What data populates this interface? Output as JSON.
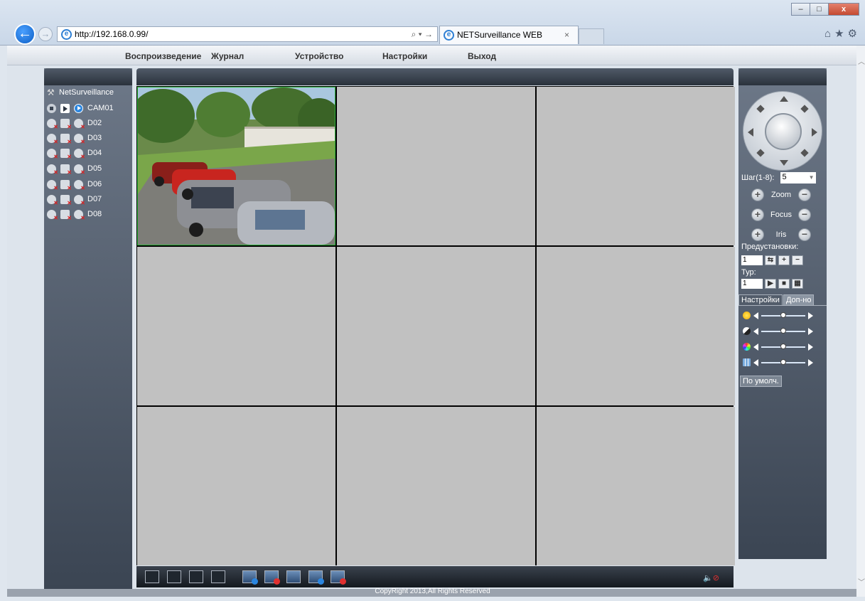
{
  "browser": {
    "url": "http://192.168.0.99/",
    "address_tools": "⌕ ▾ →",
    "tab_title": "NETSurveillance WEB",
    "tab_close": "×",
    "window_controls": [
      "–",
      "□",
      "x"
    ],
    "icons": [
      "home-icon",
      "star-icon",
      "gear-icon"
    ]
  },
  "menu": {
    "items": [
      "Воспроизведение",
      "Журнал",
      "Устройство",
      "Настройки",
      "Выход"
    ]
  },
  "device_tree": {
    "root": "NetSurveillance",
    "channels": [
      {
        "name": "CAM01",
        "state": "connected"
      },
      {
        "name": "D02",
        "state": "disconnected"
      },
      {
        "name": "D03",
        "state": "disconnected"
      },
      {
        "name": "D04",
        "state": "disconnected"
      },
      {
        "name": "D05",
        "state": "disconnected"
      },
      {
        "name": "D06",
        "state": "disconnected"
      },
      {
        "name": "D07",
        "state": "disconnected"
      },
      {
        "name": "D08",
        "state": "disconnected"
      }
    ]
  },
  "video_grid": {
    "layout": "3x3",
    "active_cell": 1
  },
  "ptz": {
    "step_label": "Шаг(1-8):",
    "step_value": "5",
    "zoom_label": "Zoom",
    "focus_label": "Focus",
    "iris_label": "Iris",
    "presets_label": "Предустановки:",
    "preset_value": "1",
    "tour_label": "Тур:",
    "tour_value": "1"
  },
  "image_settings": {
    "tab_active": "Настройки",
    "tab_inactive": "Доп-но",
    "sliders": [
      {
        "name": "brightness",
        "level": 0.5
      },
      {
        "name": "contrast",
        "level": 0.5
      },
      {
        "name": "saturation",
        "level": 0.5
      },
      {
        "name": "hue",
        "level": 0.5
      }
    ],
    "default_button": "По умолч."
  },
  "toolbar": {
    "buttons": [
      "fullscreen",
      "layout-1",
      "layout-4",
      "layout-9",
      "play-all",
      "stop-all",
      "snapshot",
      "record",
      "stop-record"
    ],
    "audio_icon": "🔈",
    "mute_icon": "⊘"
  },
  "footer": {
    "copyright": "CopyRight 2013,All Rights Reserved"
  },
  "colors": {
    "panel": "#3b4553",
    "active_border": "#2db43a",
    "empty_cell": "#c1c1c1"
  }
}
